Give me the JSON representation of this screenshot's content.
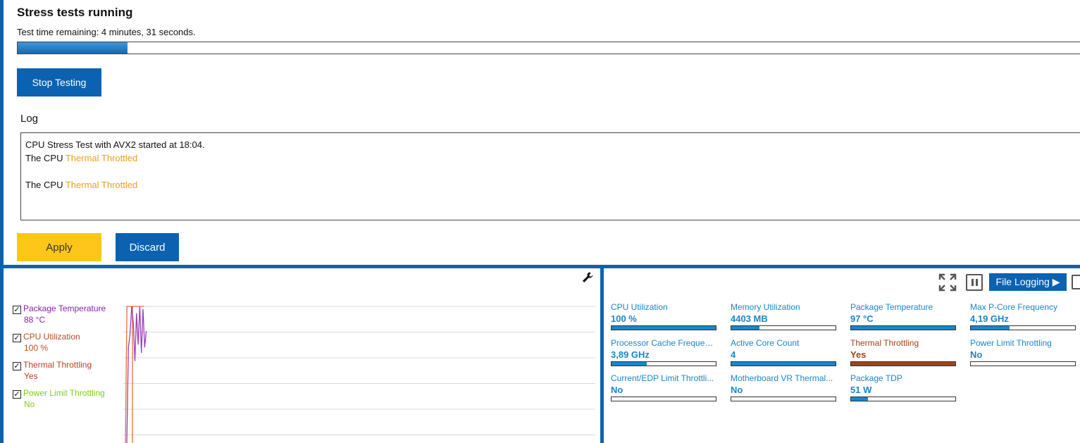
{
  "header": {
    "title": "Stress tests running",
    "time_remaining": "Test time remaining: 4 minutes, 31 seconds.",
    "progress_fraction": 0.103
  },
  "buttons": {
    "stop": "Stop Testing",
    "apply": "Apply",
    "discard": "Discard",
    "file_logging": "File Logging ▶"
  },
  "log": {
    "label": "Log",
    "lines": [
      {
        "prefix": "CPU Stress Test with AVX2 started at 18:04.",
        "highlight": ""
      },
      {
        "prefix": "The CPU ",
        "highlight": "Thermal Throttled"
      },
      {
        "prefix": "",
        "highlight": ""
      },
      {
        "prefix": "The CPU ",
        "highlight": "Thermal Throttled"
      }
    ]
  },
  "chart": {
    "legend": [
      {
        "label": "Package Temperature",
        "value": "88 °C",
        "checked": true,
        "color": "#8b1fa8"
      },
      {
        "label": "CPU Utilization",
        "value": "100 %",
        "checked": true,
        "color": "#b5501a"
      },
      {
        "label": "Thermal Throttling",
        "value": "Yes",
        "checked": true,
        "color": "#c2391e"
      },
      {
        "label": "Power Limit Throttling",
        "value": "No",
        "checked": true,
        "color": "#7ccf1d"
      }
    ],
    "colors": {
      "grid": "#d9d9d9",
      "package_temp": "#9b3fb5",
      "cpu_util": "#e0703a"
    }
  },
  "chart_data": {
    "type": "line",
    "title": "",
    "xlabel": "",
    "ylabel": "",
    "ylim": [
      0,
      100
    ],
    "grid": true,
    "legend_placement": "left",
    "x": [
      0,
      1,
      2,
      3,
      4,
      5,
      6,
      7,
      8,
      9,
      10,
      11,
      12
    ],
    "series": [
      {
        "name": "Package Temperature",
        "values": [
          0,
          70,
          80,
          100,
          88,
          60,
          95,
          72,
          100,
          66,
          98,
          70,
          82
        ]
      },
      {
        "name": "CPU Utilization",
        "values": [
          0,
          100,
          100,
          100,
          100,
          100,
          100,
          100,
          100,
          100,
          100,
          100,
          100
        ]
      }
    ]
  },
  "metrics": [
    {
      "label": "CPU Utilization",
      "value": "100 %",
      "fill": 1.0,
      "status": "normal"
    },
    {
      "label": "Memory Utilization",
      "value": "4403  MB",
      "fill": 0.27,
      "status": "normal"
    },
    {
      "label": "Package Temperature",
      "value": "97 °C",
      "fill": 1.0,
      "status": "normal"
    },
    {
      "label": "Max P-Core Frequency",
      "value": "4,19 GHz",
      "fill": 0.37,
      "status": "normal"
    },
    {
      "label": "Processor Cache Frequency",
      "value": "3,89 GHz",
      "fill": 0.34,
      "status": "normal"
    },
    {
      "label": "Active Core Count",
      "value": "4",
      "fill": 1.0,
      "status": "normal"
    },
    {
      "label": "Thermal Throttling",
      "value": "Yes",
      "fill": 1.0,
      "status": "warn"
    },
    {
      "label": "Power Limit Throttling",
      "value": "No",
      "fill": 0.0,
      "status": "normal"
    },
    {
      "label": "Current/EDP Limit Throttli...",
      "value": "No",
      "fill": 0.0,
      "status": "normal"
    },
    {
      "label": "Motherboard VR Thermal...",
      "value": "No",
      "fill": 0.0,
      "status": "normal"
    },
    {
      "label": "Package TDP",
      "value": "51 W",
      "fill": 0.16,
      "status": "normal"
    }
  ]
}
